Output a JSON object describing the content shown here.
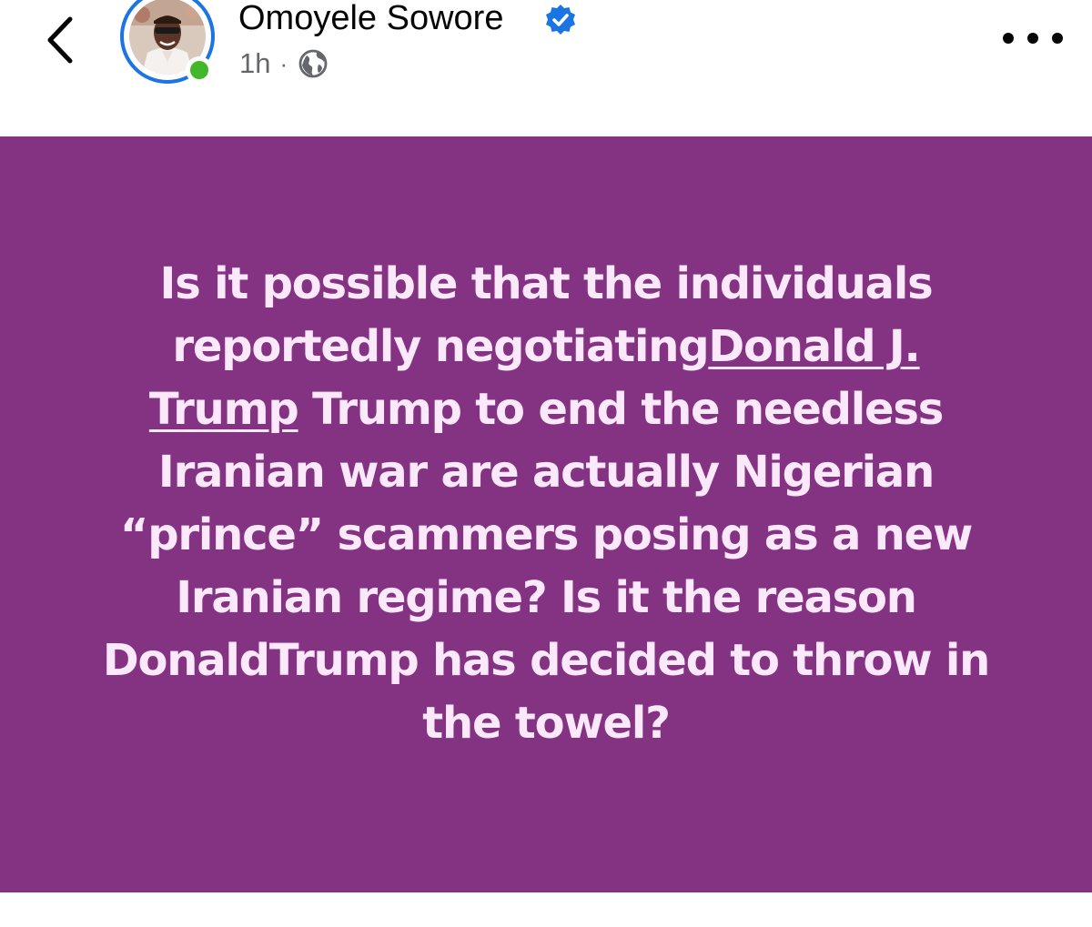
{
  "post": {
    "author": "Omoyele Sowore",
    "time": "1h",
    "separator": "·",
    "audience_icon": "globe-icon",
    "verified_icon": "verified-badge-icon",
    "online": true,
    "text_parts": {
      "before_mention": "Is it possible that the individuals reportedly negotiating",
      "mention": "Donald J. Trump",
      "after_mention": " Trump to end the needless Iranian war are actually Nigerian “prince” scammers posing as a new Iranian regime? Is it the reason DonaldTrump has decided to throw in the towel?"
    }
  },
  "navigation": {
    "back_icon": "chevron-left-icon",
    "more_icon": "more-options-icon"
  },
  "colors": {
    "background_card": "#833381",
    "post_text": "#fbe8fb",
    "verified_blue": "#1b74e4",
    "online_green": "#42b72a",
    "meta_gray": "#65676b"
  }
}
